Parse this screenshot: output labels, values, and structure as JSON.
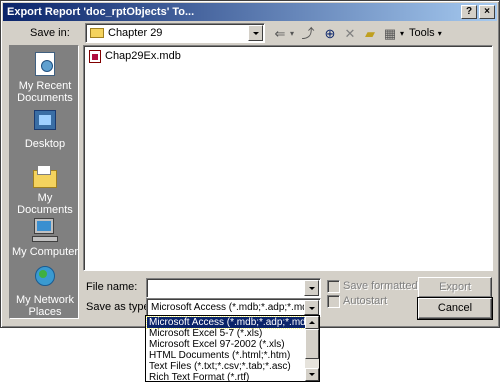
{
  "window": {
    "title": "Export Report 'doc_rptObjects' To..."
  },
  "save_in": {
    "label": "Save in:",
    "value": "Chapter 29"
  },
  "toolbar": {
    "tools_label": "Tools"
  },
  "places": [
    {
      "label": "My Recent Documents",
      "icon": "recent-documents-icon"
    },
    {
      "label": "Desktop",
      "icon": "desktop-icon"
    },
    {
      "label": "My Documents",
      "icon": "my-documents-icon"
    },
    {
      "label": "My Computer",
      "icon": "my-computer-icon"
    },
    {
      "label": "My Network Places",
      "icon": "network-places-icon"
    }
  ],
  "files": [
    {
      "name": "Chap29Ex.mdb"
    }
  ],
  "file_name": {
    "label": "File name:",
    "value": ""
  },
  "save_as_type": {
    "label": "Save as type:",
    "value": "Microsoft Access (*.mdb;*.adp;*.mda;",
    "options": [
      "Microsoft Access (*.mdb;*.adp;*.mda;",
      "Microsoft Excel 5-7 (*.xls)",
      "Microsoft Excel 97-2002 (*.xls)",
      "HTML Documents (*.html;*.htm)",
      "Text Files (*.txt;*.csv;*.tab;*.asc)",
      "Rich Text Format (*.rtf)"
    ]
  },
  "checkboxes": {
    "save_formatted": "Save formatted",
    "autostart": "Autostart"
  },
  "buttons": {
    "export": "Export",
    "cancel": "Cancel"
  },
  "titlebar_buttons": {
    "help": "?",
    "close": "×"
  }
}
